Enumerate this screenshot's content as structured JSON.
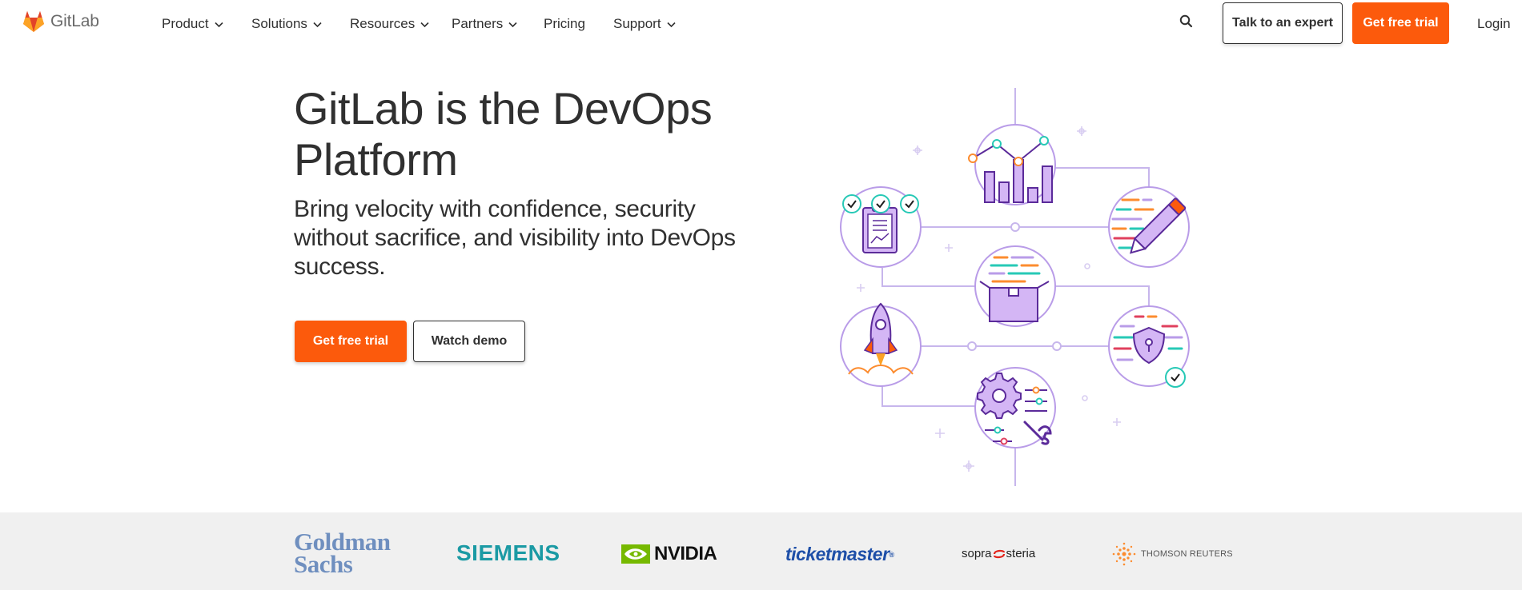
{
  "brand": {
    "name": "GitLab",
    "accent": "#fc5a0c",
    "logo_color": "#e24329"
  },
  "nav": {
    "items": [
      {
        "label": "Product",
        "has_dropdown": true
      },
      {
        "label": "Solutions",
        "has_dropdown": true
      },
      {
        "label": "Resources",
        "has_dropdown": true
      },
      {
        "label": "Partners",
        "has_dropdown": true
      },
      {
        "label": "Pricing",
        "has_dropdown": false
      },
      {
        "label": "Support",
        "has_dropdown": true
      }
    ],
    "search_icon": "search-icon",
    "talk_label": "Talk to an expert",
    "trial_label": "Get free trial",
    "login_label": "Login"
  },
  "hero": {
    "title": "GitLab is the DevOps Platform",
    "subtitle": "Bring velocity with confidence, security without sacrifice, and visibility into DevOps success.",
    "primary_cta": "Get free trial",
    "secondary_cta": "Watch demo"
  },
  "clients": [
    {
      "name": "Goldman Sachs",
      "line1": "Goldman",
      "line2": "Sachs"
    },
    {
      "name": "SIEMENS"
    },
    {
      "name": "NVIDIA"
    },
    {
      "name": "ticketmaster",
      "mark": "®"
    },
    {
      "name": "sopra steria",
      "part1": "sopra",
      "part2": "steria"
    },
    {
      "name": "THOMSON REUTERS"
    }
  ]
}
